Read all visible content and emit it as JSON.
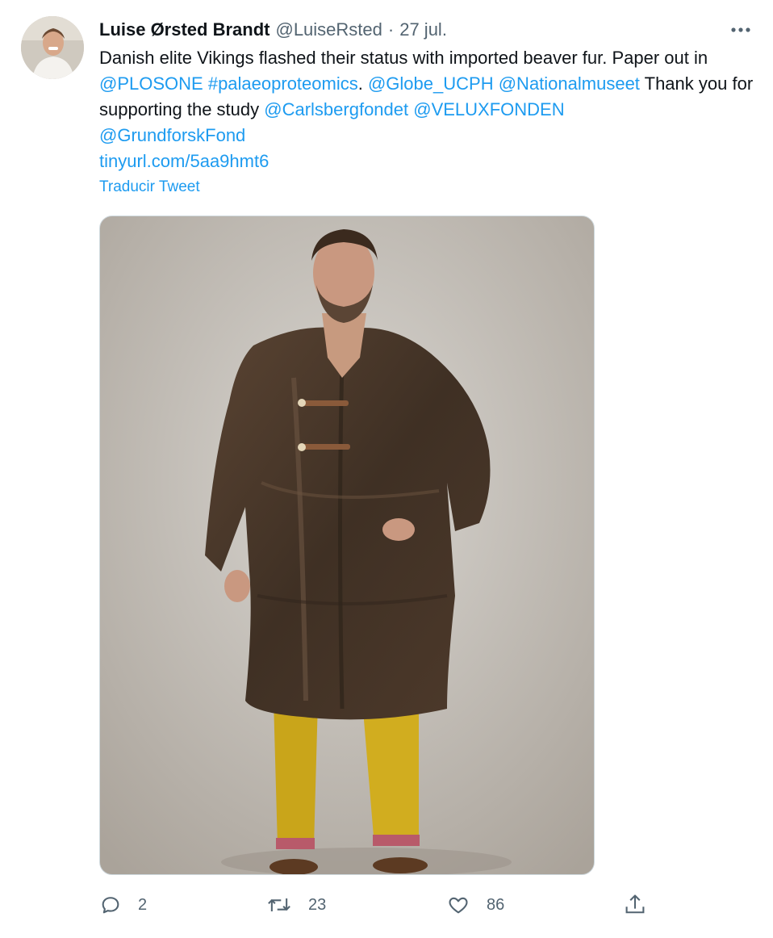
{
  "tweet": {
    "author_name": "Luise Ørsted Brandt",
    "author_handle": "@LuiseRsted",
    "separator": "·",
    "date": "27 jul.",
    "text_parts": {
      "t1": "Danish elite Vikings flashed their status with imported beaver fur. Paper out in ",
      "l1": "@PLOSONE",
      "t2": " ",
      "l2": "#palaeoproteomics",
      "t3": ". ",
      "l3": "@Globe_UCPH",
      "t4": " ",
      "l4": "@Nationalmuseet",
      "t5": " Thank you for supporting the study ",
      "l5": "@Carlsbergfondet",
      "t6": " ",
      "l6": "@VELUXFONDEN",
      "l7": "@GrundforskFond",
      "l8": "tinyurl.com/5aa9hmt6"
    },
    "translate_label": "Traducir Tweet",
    "media_icon": "photo"
  },
  "actions": {
    "reply": {
      "icon": "reply-icon",
      "count": "2"
    },
    "retweet": {
      "icon": "retweet-icon",
      "count": "23"
    },
    "like": {
      "icon": "heart-icon",
      "count": "86"
    },
    "share": {
      "icon": "share-icon"
    }
  },
  "colors": {
    "link": "#1d9bf0",
    "secondary": "#536471",
    "text": "#0f1419"
  }
}
